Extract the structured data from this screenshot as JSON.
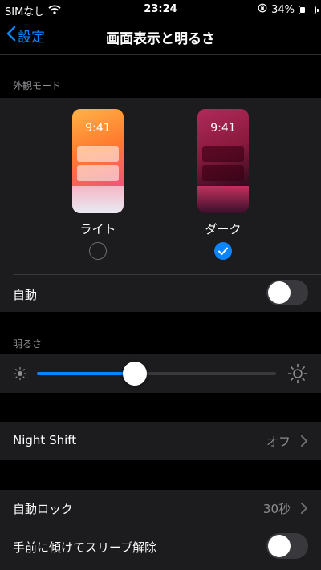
{
  "status": {
    "carrier": "SIMなし",
    "time": "23:24",
    "battery": "34%",
    "battery_level": 0.34
  },
  "nav": {
    "back_label": "設定",
    "title": "画面表示と明るさ"
  },
  "appearance": {
    "header": "外観モード",
    "light": {
      "label": "ライト",
      "preview_time": "9:41",
      "selected": false
    },
    "dark": {
      "label": "ダーク",
      "preview_time": "9:41",
      "selected": true
    },
    "auto_label": "自動",
    "auto_on": false
  },
  "brightness": {
    "header": "明るさ",
    "level": 0.41
  },
  "night_shift": {
    "label": "Night Shift",
    "value": "オフ"
  },
  "auto_lock": {
    "label": "自動ロック",
    "value": "30秒"
  },
  "raise_to_wake": {
    "label": "手前に傾けてスリープ解除",
    "on": false
  },
  "colors": {
    "accent": "#0a84ff",
    "group_bg": "#1c1c1e",
    "secondary_text": "#8e8e93"
  }
}
